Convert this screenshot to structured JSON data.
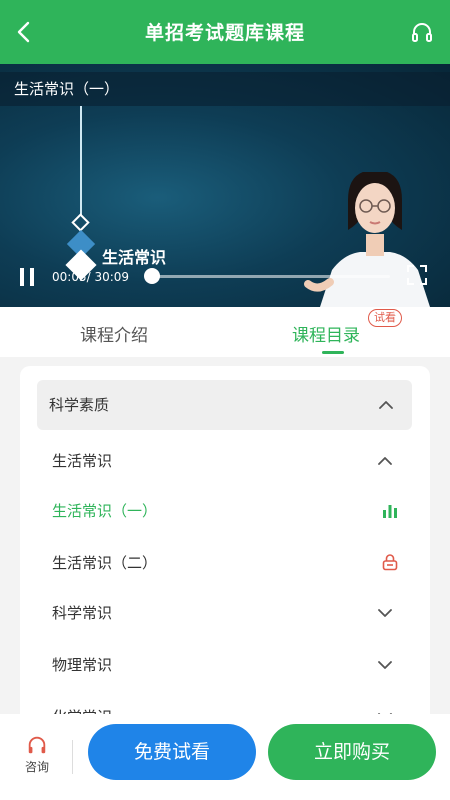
{
  "header": {
    "title": "单招考试题库课程"
  },
  "video": {
    "title": "生活常识（一）",
    "slide_label": "生活常识",
    "time": "00:05/ 30:09",
    "progress": 0.003
  },
  "tabs": {
    "intro": "课程介绍",
    "catalog": "课程目录",
    "trial_badge": "试看"
  },
  "catalog": {
    "section": "科学素质",
    "group": "生活常识",
    "lessons": [
      {
        "label": "生活常识（一）",
        "state": "playing"
      },
      {
        "label": "生活常识（二）",
        "state": "locked"
      }
    ],
    "groups_collapsed": [
      "科学常识",
      "物理常识",
      "化学常识"
    ]
  },
  "bottom": {
    "consult": "咨询",
    "free_trial": "免费试看",
    "buy_now": "立即购买"
  },
  "colors": {
    "brand_green": "#2fb45a",
    "trial_blue": "#1f84e8",
    "lock_red": "#e05a4a"
  }
}
